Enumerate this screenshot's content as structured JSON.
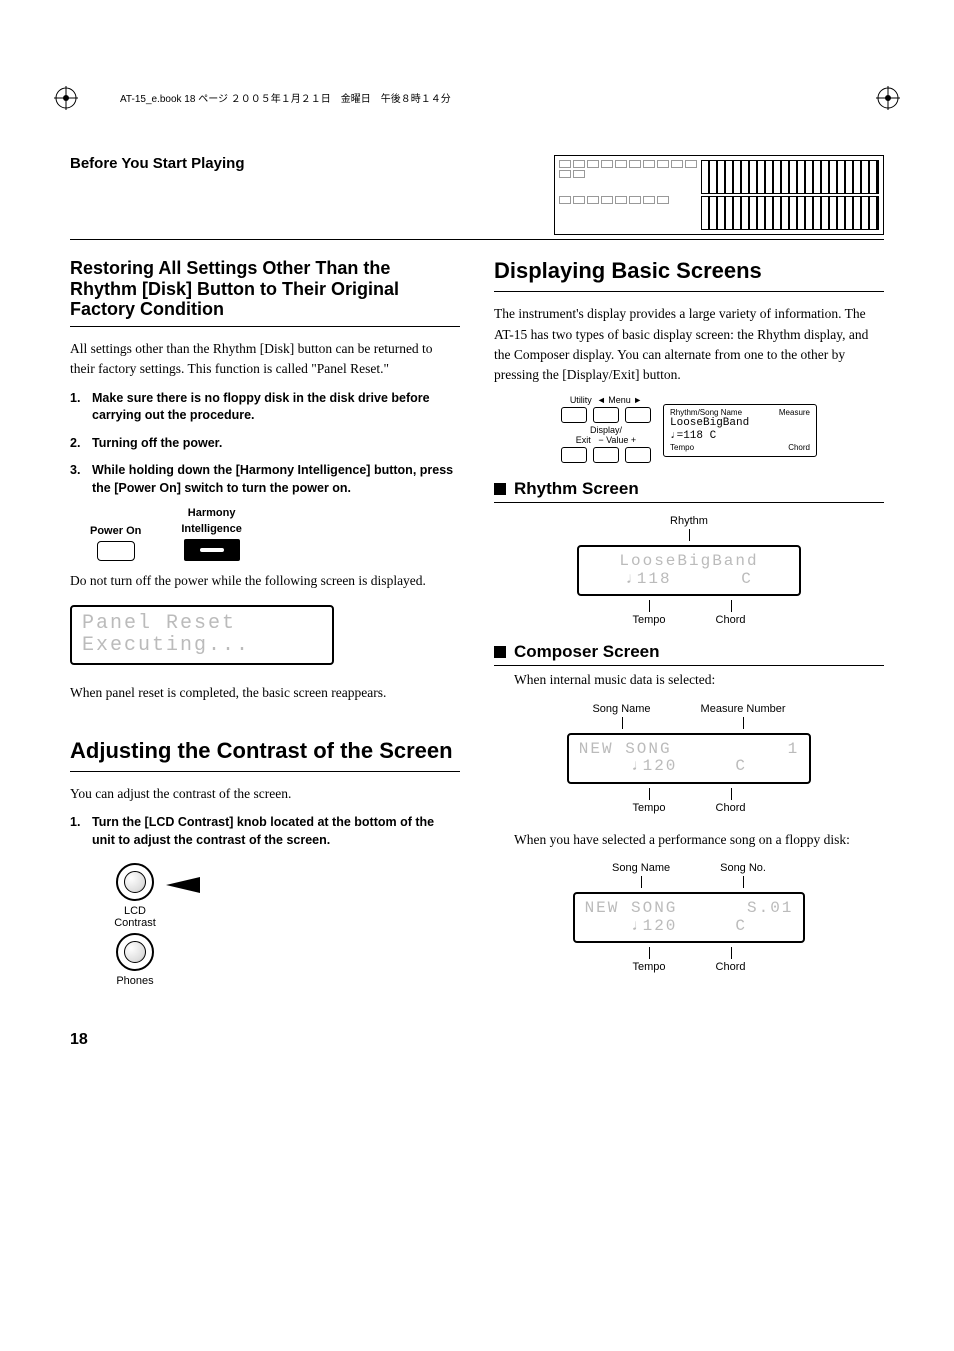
{
  "meta": {
    "header_note": "AT-15_e.book 18 ページ ２００５年１月２１日　金曜日　午後８時１４分",
    "page_number": "18"
  },
  "breadcrumb": "Before You Start Playing",
  "left": {
    "h_restore": "Restoring All Settings Other Than the Rhythm [Disk] Button to Their Original Factory Condition",
    "restore_intro": "All settings other than the Rhythm [Disk] button can be returned to their factory settings. This function is called \"Panel Reset.\"",
    "steps": [
      "Make sure there is no floppy disk in the disk drive before carrying out the procedure.",
      "Turning off the power.",
      "While holding down the [Harmony Intelligence] button, press the [Power On] switch to turn the power on."
    ],
    "btn_power_label": "Power On",
    "btn_harmony_label_1": "Harmony",
    "btn_harmony_label_2": "Intelligence",
    "restore_note": "Do not turn off the power while the following screen is displayed.",
    "lcd_panel_reset_1": "Panel Reset",
    "lcd_panel_reset_2": "Executing...",
    "restore_done": "When panel reset is completed, the basic screen reappears.",
    "h_contrast": "Adjusting the Contrast of the Screen",
    "contrast_intro": "You can adjust the contrast of the screen.",
    "contrast_step": "Turn the [LCD Contrast] knob located at the bottom of the unit to adjust the contrast of the screen.",
    "knob_lcd_label_1": "LCD",
    "knob_lcd_label_2": "Contrast",
    "knob_phones_label": "Phones"
  },
  "right": {
    "h_basic": "Displaying Basic Screens",
    "basic_intro": "The instrument's display provides a large variety of information. The AT-15 has two types of basic display screen: the Rhythm display, and the Composer display. You can alternate from one to the other by pressing the [Display/Exit] button.",
    "menu": {
      "utility": "Utility",
      "menu": "Menu",
      "display_exit_1": "Display/",
      "display_exit_2": "Exit",
      "value": "− Value +",
      "lcd_top_left": "Rhythm/Song Name",
      "lcd_top_right": "Measure",
      "lcd_line1": "LooseBigBand",
      "lcd_line2": "♩=118   C",
      "lcd_bot_left": "Tempo",
      "lcd_bot_right": "Chord"
    },
    "h_rhythm": "Rhythm Screen",
    "rhythm_top_label": "Rhythm",
    "rhythm_lcd_1": "LooseBigBand",
    "rhythm_lcd_2": "♩118      C",
    "rhythm_bot_tempo": "Tempo",
    "rhythm_bot_chord": "Chord",
    "h_composer": "Composer Screen",
    "composer_intro": "When internal music data is selected:",
    "comp1_top_left": "Song Name",
    "comp1_top_right": "Measure Number",
    "comp1_lcd_1": "NEW SONG          1",
    "comp1_lcd_2": "♩120     C",
    "comp1_bot_tempo": "Tempo",
    "comp1_bot_chord": "Chord",
    "composer_floppy": "When you have selected a performance song on a floppy disk:",
    "comp2_top_left": "Song Name",
    "comp2_top_right": "Song No.",
    "comp2_lcd_1": "NEW SONG      S.01",
    "comp2_lcd_2": "♩120     C",
    "comp2_bot_tempo": "Tempo",
    "comp2_bot_chord": "Chord"
  }
}
